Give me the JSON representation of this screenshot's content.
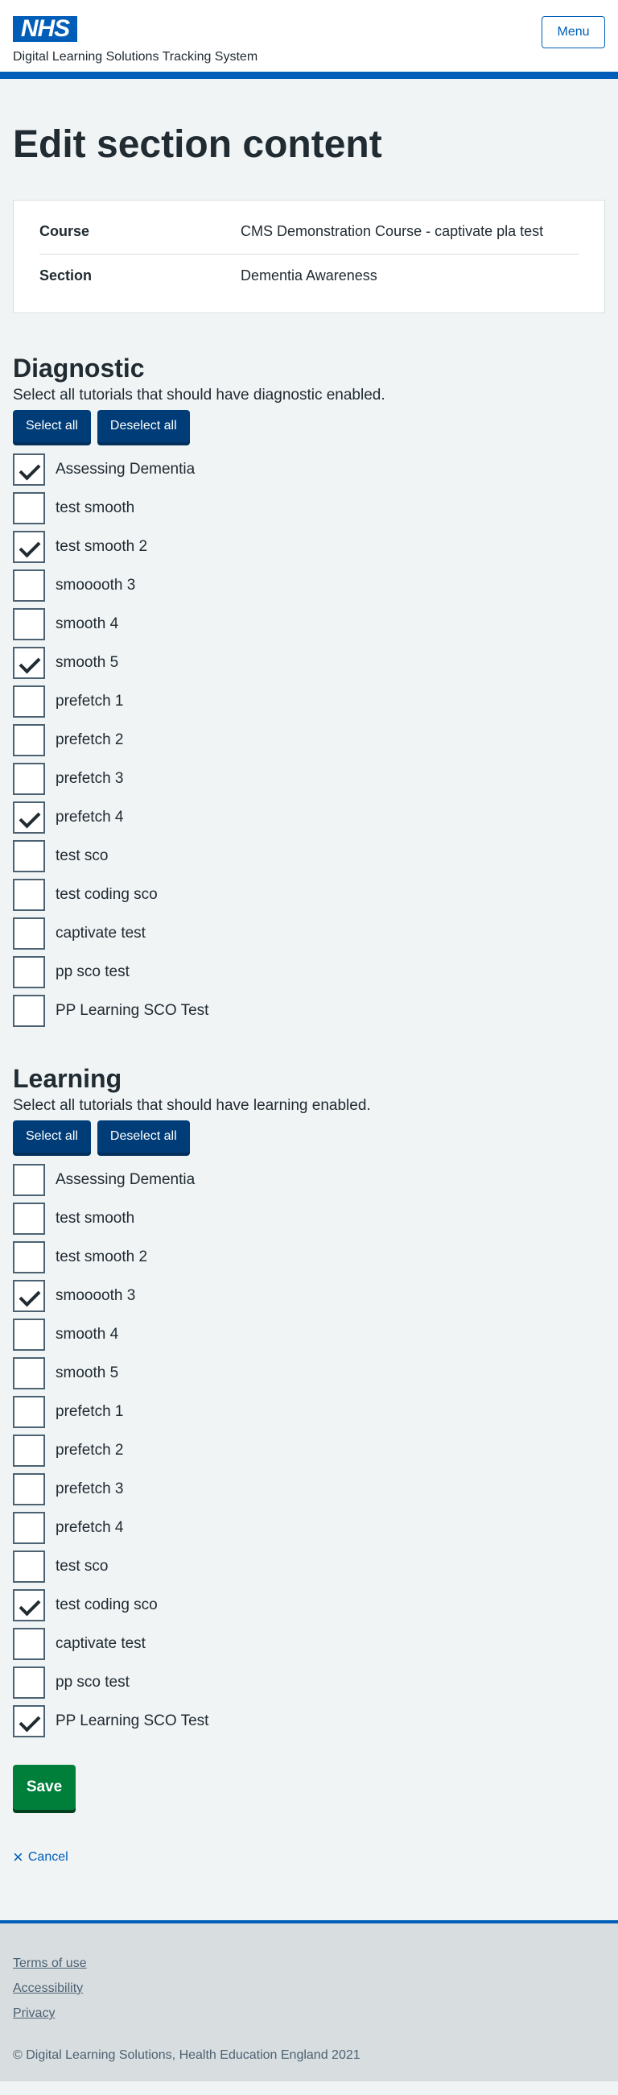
{
  "header": {
    "logo_text": "NHS",
    "service_name": "Digital Learning Solutions Tracking System",
    "menu_label": "Menu"
  },
  "page": {
    "title": "Edit section content"
  },
  "summary": {
    "course_key": "Course",
    "course_value": "CMS Demonstration Course - captivate pla test",
    "section_key": "Section",
    "section_value": "Dementia Awareness"
  },
  "diagnostic": {
    "heading": "Diagnostic",
    "hint": "Select all tutorials that should have diagnostic enabled.",
    "select_all": "Select all",
    "deselect_all": "Deselect all",
    "items": [
      {
        "label": "Assessing Dementia",
        "checked": true
      },
      {
        "label": "test smooth",
        "checked": false
      },
      {
        "label": "test smooth 2",
        "checked": true
      },
      {
        "label": "smooooth 3",
        "checked": false
      },
      {
        "label": "smooth 4",
        "checked": false
      },
      {
        "label": "smooth 5",
        "checked": true
      },
      {
        "label": "prefetch 1",
        "checked": false
      },
      {
        "label": "prefetch 2",
        "checked": false
      },
      {
        "label": "prefetch 3",
        "checked": false
      },
      {
        "label": "prefetch 4",
        "checked": true
      },
      {
        "label": "test sco",
        "checked": false
      },
      {
        "label": "test coding sco",
        "checked": false
      },
      {
        "label": "captivate test",
        "checked": false
      },
      {
        "label": "pp sco test",
        "checked": false
      },
      {
        "label": "PP Learning SCO Test",
        "checked": false
      }
    ]
  },
  "learning": {
    "heading": "Learning",
    "hint": "Select all tutorials that should have learning enabled.",
    "select_all": "Select all",
    "deselect_all": "Deselect all",
    "items": [
      {
        "label": "Assessing Dementia",
        "checked": false
      },
      {
        "label": "test smooth",
        "checked": false
      },
      {
        "label": "test smooth 2",
        "checked": false
      },
      {
        "label": "smooooth 3",
        "checked": true
      },
      {
        "label": "smooth 4",
        "checked": false
      },
      {
        "label": "smooth 5",
        "checked": false
      },
      {
        "label": "prefetch 1",
        "checked": false
      },
      {
        "label": "prefetch 2",
        "checked": false
      },
      {
        "label": "prefetch 3",
        "checked": false
      },
      {
        "label": "prefetch 4",
        "checked": false
      },
      {
        "label": "test sco",
        "checked": false
      },
      {
        "label": "test coding sco",
        "checked": true
      },
      {
        "label": "captivate test",
        "checked": false
      },
      {
        "label": "pp sco test",
        "checked": false
      },
      {
        "label": "PP Learning SCO Test",
        "checked": true
      }
    ]
  },
  "actions": {
    "save_label": "Save",
    "cancel_label": "Cancel",
    "cancel_icon": "close-icon"
  },
  "footer": {
    "links": [
      "Terms of use",
      "Accessibility",
      "Privacy"
    ],
    "copyright": "© Digital Learning Solutions, Health Education England 2021"
  },
  "colors": {
    "brand_blue": "#005eb8",
    "button_dark_blue": "#003d78",
    "save_green": "#007f3b",
    "text": "#212b32",
    "background": "#f0f4f5"
  }
}
